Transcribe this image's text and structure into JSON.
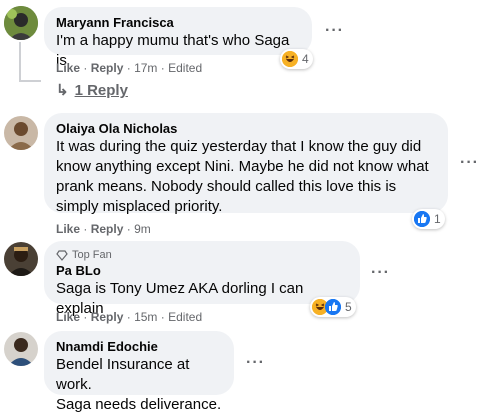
{
  "comments": [
    {
      "author": "Maryann Francisca",
      "text": "I'm a happy mumu that's who Saga is",
      "like": "Like",
      "reply": "Reply",
      "time": "17m",
      "edited": "Edited",
      "reaction_count": "4",
      "reactions": [
        "haha-icon"
      ],
      "replies_label": "1 Reply"
    },
    {
      "author": "Olaiya Ola Nicholas",
      "text_lines": [
        "It was during the quiz yesterday that I know the guy did",
        "know anything except Nini. Maybe he did not know what",
        "prank means. Nobody should called this love this is",
        "simply misplaced priority."
      ],
      "like": "Like",
      "reply": "Reply",
      "time": "9m",
      "reaction_count": "1",
      "reactions": [
        "like-icon"
      ]
    },
    {
      "badge": "Top Fan",
      "author": "Pa BLo",
      "text": "Saga is Tony Umez AKA dorling I can explain",
      "like": "Like",
      "reply": "Reply",
      "time": "15m",
      "edited": "Edited",
      "reaction_count": "5",
      "reactions": [
        "haha-icon",
        "like-icon"
      ]
    },
    {
      "author": "Nnamdi Edochie",
      "text_lines": [
        "Bendel Insurance at work.",
        "Saga needs deliverance."
      ]
    }
  ],
  "separator": "·",
  "more_icon": "more-options-icon",
  "colors": {
    "bubble": "#f0f2f5",
    "meta": "#65676b",
    "like_blue": "#1877f2",
    "haha_yellow": "#f7b125"
  }
}
